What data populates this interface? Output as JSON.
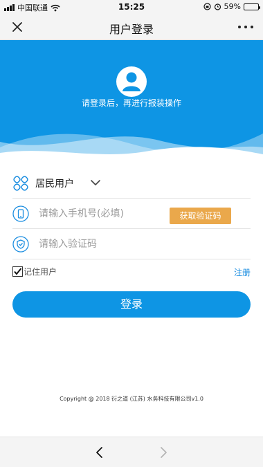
{
  "status_bar": {
    "carrier": "中国联通",
    "time": "15:25",
    "battery": "59%",
    "battery_level": 0.59,
    "icons": [
      "signal-icon",
      "wifi-icon",
      "lock-rotation-icon",
      "alarm-icon",
      "battery-icon"
    ]
  },
  "nav": {
    "title": "用户登录",
    "icons": [
      "close-icon",
      "more-icon"
    ]
  },
  "banner": {
    "prompt": "请登录后，再进行报装操作",
    "colors": {
      "primary": "#0e95e4"
    }
  },
  "form": {
    "user_type": "居民用户",
    "phone_placeholder": "请输入手机号(必填)",
    "get_code_label": "获取验证码",
    "code_placeholder": "请输入验证码",
    "remember_label": "记住用户",
    "remember_checked": true,
    "register_label": "注册",
    "login_label": "登录",
    "colors": {
      "get_code": "#eaa84b",
      "link": "#1a8de0"
    }
  },
  "footer": {
    "copyright": "Copyright @ 2018 衍之道 (江苏) 水务科技有限公司v1.0"
  },
  "toolbar": {
    "icons": [
      "back-icon",
      "forward-icon"
    ]
  }
}
